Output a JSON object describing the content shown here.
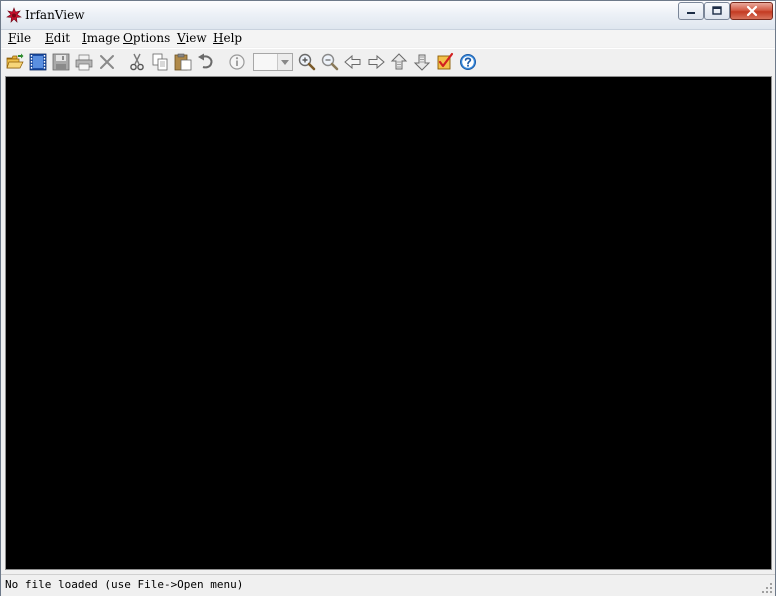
{
  "window": {
    "title": "IrfanView"
  },
  "menubar": {
    "items": [
      {
        "label_ul": "F",
        "label_rest": "ile"
      },
      {
        "label_ul": "E",
        "label_rest": "dit"
      },
      {
        "label_ul": "I",
        "label_rest": "mage"
      },
      {
        "label_ul": "O",
        "label_rest": "ptions"
      },
      {
        "label_ul": "V",
        "label_rest": "iew"
      },
      {
        "label_ul": "H",
        "label_rest": "elp"
      }
    ]
  },
  "toolbar": {
    "icons": [
      "open-folder-icon",
      "slideshow-icon",
      "save-icon",
      "print-icon",
      "delete-icon",
      "cut-icon",
      "copy-icon",
      "paste-icon",
      "undo-icon",
      "info-icon",
      "zoom-in-icon",
      "zoom-out-icon",
      "previous-icon",
      "next-icon",
      "previous-page-icon",
      "next-page-icon",
      "thumbnails-icon",
      "help-icon"
    ],
    "zoom_combo_value": ""
  },
  "viewer": {
    "background": "#000000"
  },
  "statusbar": {
    "text": "No file loaded (use File->Open menu)"
  }
}
